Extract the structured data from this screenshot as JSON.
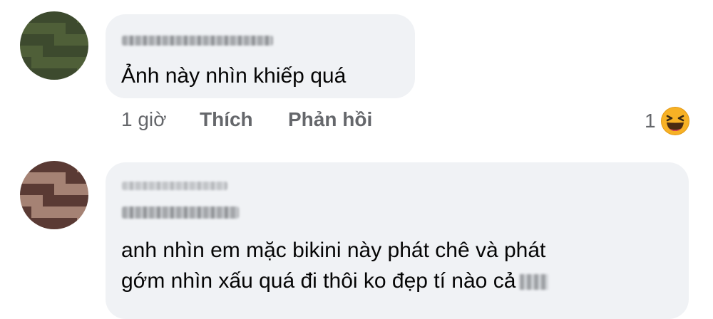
{
  "comments": [
    {
      "text": "Ảnh này nhìn khiếp quá",
      "time": "1 giờ",
      "like_label": "Thích",
      "reply_label": "Phản hồi",
      "reaction_count": "1",
      "reaction_icon": "laugh-emoji-icon"
    },
    {
      "text_line_1": "anh nhìn em mặc bikini này  phát chê và phát",
      "text_line_2": "gớm nhìn xấu quá đi thôi ko đẹp tí nào cả"
    }
  ],
  "colors": {
    "bubble": "#f0f2f5",
    "text": "#050505",
    "meta": "#65676b",
    "emoji_yellow": "#f7b125"
  }
}
